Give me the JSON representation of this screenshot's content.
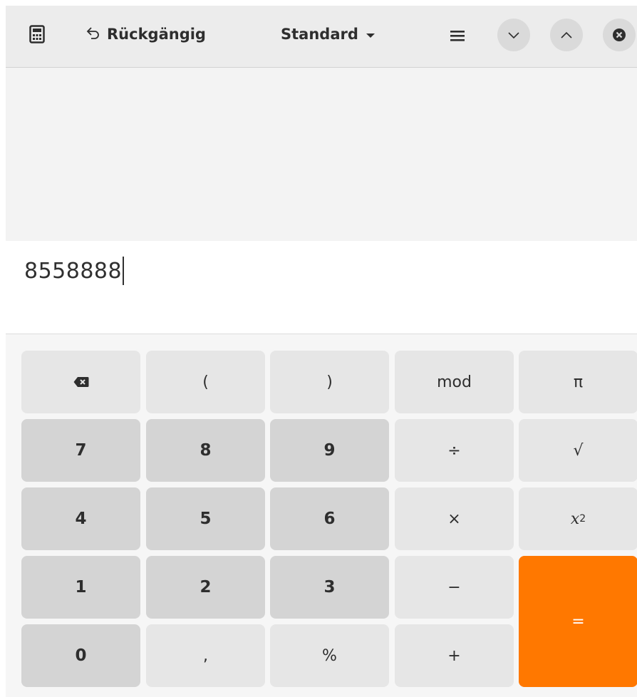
{
  "header": {
    "undo_label": "Rückgängig",
    "mode_label": "Standard",
    "icons": {
      "app": "calculator-icon",
      "undo": "undo-icon",
      "mode_dropdown": "chevron-down-icon",
      "menu": "hamburger-menu-icon",
      "minimize": "minimize-icon",
      "maximize": "maximize-icon",
      "close": "close-icon"
    }
  },
  "display": {
    "input_value": "8558888"
  },
  "keypad": {
    "row1": [
      "⌫",
      "(",
      ")",
      "mod",
      "π"
    ],
    "row2": [
      "7",
      "8",
      "9",
      "÷",
      "√"
    ],
    "row3": [
      "4",
      "5",
      "6",
      "×",
      "x²"
    ],
    "row4": [
      "1",
      "2",
      "3",
      "−",
      "="
    ],
    "row5": [
      "0",
      ",",
      "%",
      "+"
    ],
    "square_base": "x",
    "square_exp": "2"
  },
  "colors": {
    "accent": "#ff7800",
    "header_bg": "#ececec",
    "history_bg": "#f3f3f3",
    "key_light": "#e6e6e6",
    "key_dark": "#d4d4d4"
  }
}
